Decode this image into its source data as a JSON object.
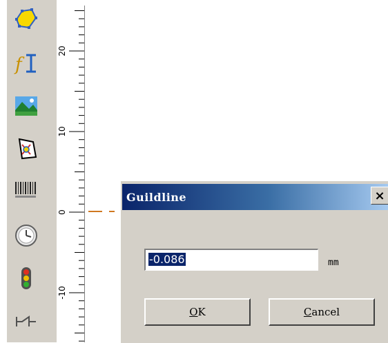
{
  "dialog": {
    "title": "Guildline",
    "close_glyph": "×",
    "value_selected": "-0.086",
    "unit": "mm",
    "ok_mnemonic": "O",
    "ok_rest": "K",
    "cancel_mnemonic": "C",
    "cancel_rest": "ancel"
  },
  "ruler": {
    "labels": [
      "20",
      "10",
      "0",
      "-10"
    ]
  },
  "toolbar": {
    "tools": [
      "polygon-tool-icon",
      "text-tool-icon",
      "image-tool-icon",
      "vector-file-icon",
      "barcode-tool-icon",
      "clock-tool-icon",
      "traffic-light-icon",
      "line-tool-icon"
    ]
  },
  "colors": {
    "title_bar_start": "#0a246a",
    "title_bar_end": "#a6caf0",
    "guide": "#d07820",
    "panel": "#d4d0c8"
  }
}
